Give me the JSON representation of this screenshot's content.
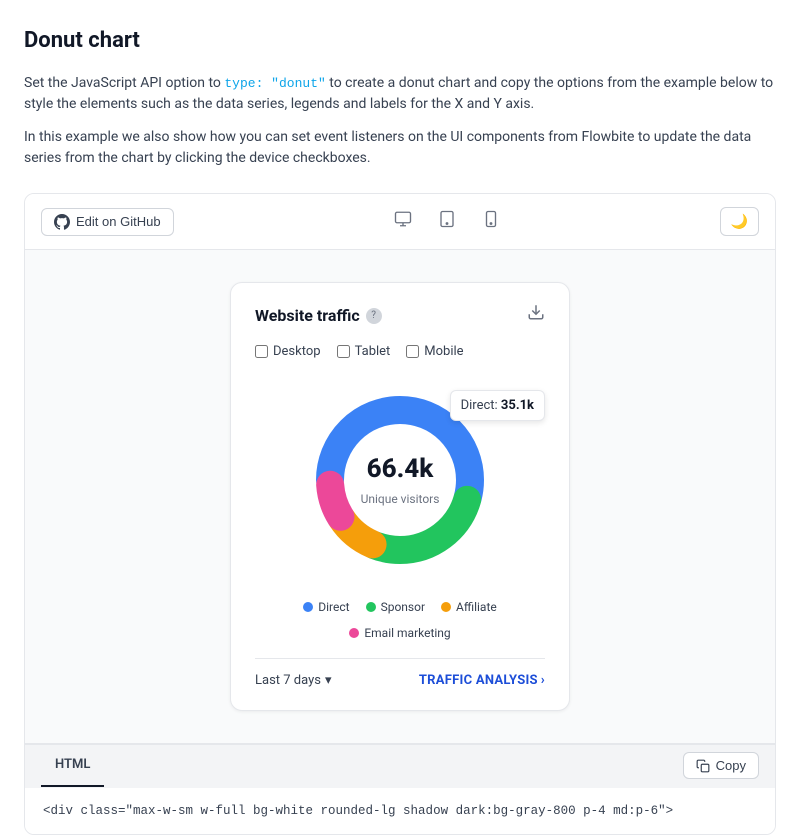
{
  "page": {
    "title": "Donut chart",
    "description1_before": "Set the JavaScript API option to ",
    "description1_highlight": "type: \"donut\"",
    "description1_after": " to create a donut chart and copy the options from the example below to style the elements such as the data series, legends and labels for the X and Y axis.",
    "description2": "In this example we also show how you can set event listeners on the UI components from Flowbite to update the data series from the chart by clicking the device checkboxes."
  },
  "toolbar": {
    "github_label": "Edit on GitHub",
    "dark_toggle": "🌙"
  },
  "chart_card": {
    "title": "Website traffic",
    "center_value": "66.4k",
    "center_label": "Unique visitors",
    "tooltip_label": "Direct:",
    "tooltip_value": "35.1k",
    "checkboxes": [
      {
        "label": "Desktop",
        "checked": false
      },
      {
        "label": "Tablet",
        "checked": false
      },
      {
        "label": "Mobile",
        "checked": false
      }
    ],
    "legend": [
      {
        "label": "Direct",
        "color": "#3b82f6"
      },
      {
        "label": "Sponsor",
        "color": "#22c55e"
      },
      {
        "label": "Affiliate",
        "color": "#f59e0b"
      },
      {
        "label": "Email marketing",
        "color": "#ec4899"
      }
    ],
    "footer": {
      "period_label": "Last 7 days",
      "period_chevron": "▾",
      "traffic_link": "TRAFFIC ANALYSIS",
      "traffic_arrow": "›"
    },
    "donut_segments": [
      {
        "color": "#3b82f6",
        "percent": 55,
        "label": "Direct"
      },
      {
        "color": "#22c55e",
        "percent": 27,
        "label": "Sponsor"
      },
      {
        "color": "#f59e0b",
        "percent": 10,
        "label": "Affiliate"
      },
      {
        "color": "#ec4899",
        "percent": 8,
        "label": "Email marketing"
      }
    ]
  },
  "code_section": {
    "tab_label": "HTML",
    "copy_label": "Copy",
    "code_line": "<div class=\"max-w-sm w-full bg-white rounded-lg shadow dark:bg-gray-800 p-4 md:p-6\">"
  }
}
